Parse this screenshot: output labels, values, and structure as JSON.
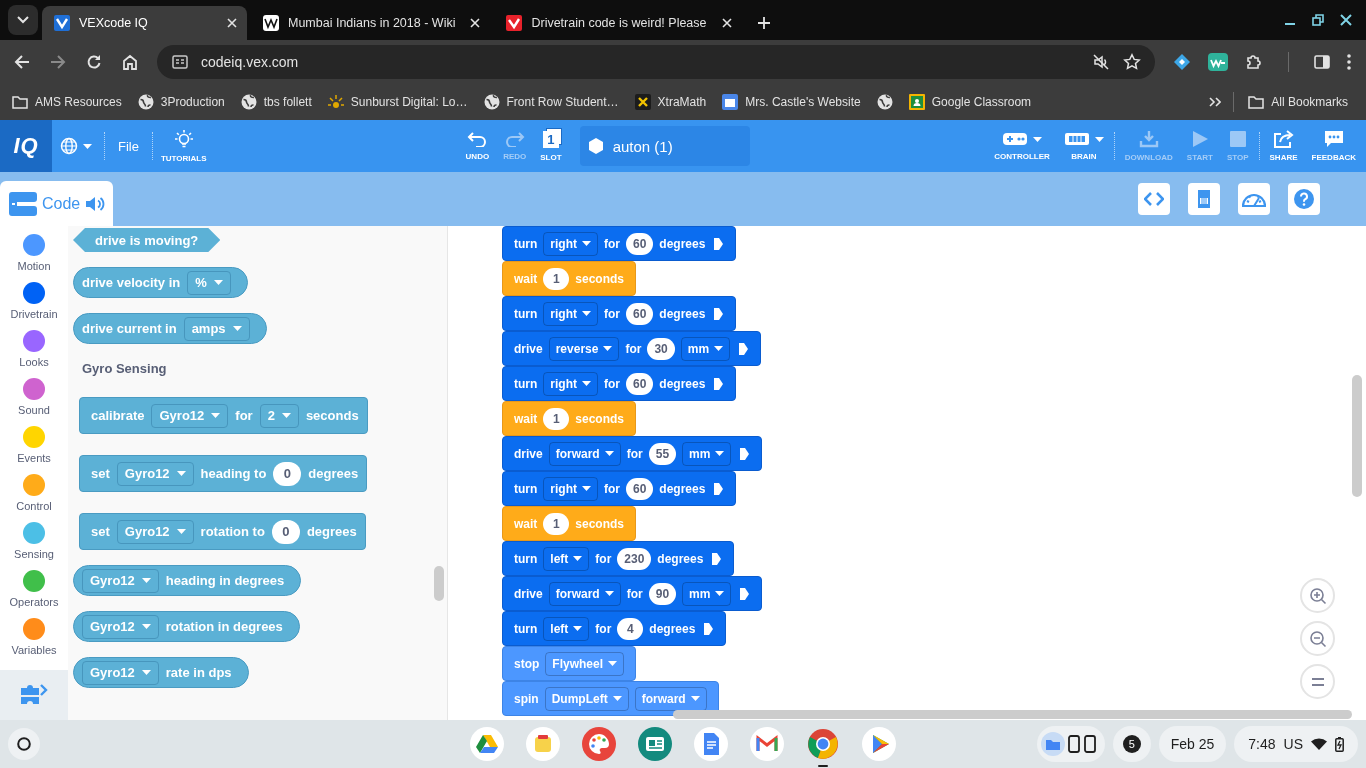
{
  "browser": {
    "tabs": [
      {
        "title": "VEXcode IQ",
        "selected": true
      },
      {
        "title": "Mumbai Indians in 2018 - Wiki",
        "selected": false
      },
      {
        "title": "Drivetrain code is weird! Please",
        "selected": false
      }
    ],
    "address": "codeiq.vex.com",
    "bookmarks": [
      {
        "kind": "folder",
        "title": "AMS Resources"
      },
      {
        "kind": "link",
        "title": "3Production"
      },
      {
        "kind": "link",
        "title": "tbs follett"
      },
      {
        "kind": "link",
        "title": "Sunburst Digital: Lo…"
      },
      {
        "kind": "link",
        "title": "Front Row Student…"
      },
      {
        "kind": "link",
        "title": "XtraMath"
      },
      {
        "kind": "link",
        "title": "Mrs. Castle's Website"
      },
      {
        "kind": "link"
      },
      {
        "kind": "link",
        "title": "Google Classroom"
      }
    ],
    "all_bookmarks": "All Bookmarks"
  },
  "app": {
    "logo": "IQ",
    "menu": "File",
    "tutorials": "TUTORIALS",
    "edit_buttons": [
      {
        "label": "UNDO",
        "disabled": false
      },
      {
        "label": "REDO",
        "disabled": true
      }
    ],
    "slot": {
      "label": "SLOT",
      "number": "1"
    },
    "project_name": "auton (1)",
    "device_buttons": [
      {
        "label": "CONTROLLER",
        "dropdown": true
      },
      {
        "label": "BRAIN",
        "dropdown": true
      }
    ],
    "run_buttons": [
      {
        "label": "DOWNLOAD",
        "disabled": true
      },
      {
        "label": "START",
        "disabled": true
      },
      {
        "label": "STOP",
        "disabled": true
      }
    ],
    "share_buttons": [
      {
        "label": "SHARE"
      },
      {
        "label": "FEEDBACK"
      }
    ],
    "code_tab": "Code"
  },
  "categories": [
    {
      "name": "Motion",
      "color": "#4c97ff"
    },
    {
      "name": "Drivetrain",
      "color": "#0062f5"
    },
    {
      "name": "Looks",
      "color": "#9966ff"
    },
    {
      "name": "Sound",
      "color": "#cf63cf"
    },
    {
      "name": "Events",
      "color": "#ffd500"
    },
    {
      "name": "Control",
      "color": "#ffab19"
    },
    {
      "name": "Sensing",
      "color": "#4cbfe6"
    },
    {
      "name": "Operators",
      "color": "#40bf4a"
    },
    {
      "name": "Variables",
      "color": "#ff8c1a"
    }
  ],
  "palette": [
    {
      "kind": "boolean",
      "parts": [
        {
          "kind": "label",
          "text": "drive is moving?"
        }
      ]
    },
    {
      "kind": "reporter",
      "parts": [
        {
          "kind": "label",
          "text": "drive velocity in"
        },
        {
          "kind": "dropdown",
          "text": "%"
        }
      ]
    },
    {
      "kind": "reporter",
      "parts": [
        {
          "kind": "label",
          "text": "drive current in"
        },
        {
          "kind": "dropdown",
          "text": "amps"
        }
      ]
    },
    {
      "kind": "heading",
      "text": "Gyro Sensing"
    },
    {
      "kind": "stack",
      "parts": [
        {
          "kind": "label",
          "text": "calibrate"
        },
        {
          "kind": "dropdown",
          "text": "Gyro12"
        },
        {
          "kind": "label",
          "text": "for"
        },
        {
          "kind": "dropdown",
          "text": "2"
        },
        {
          "kind": "label",
          "text": "seconds"
        }
      ]
    },
    {
      "kind": "stack",
      "parts": [
        {
          "kind": "label",
          "text": "set"
        },
        {
          "kind": "dropdown",
          "text": "Gyro12"
        },
        {
          "kind": "label",
          "text": "heading to"
        },
        {
          "kind": "number",
          "text": "0"
        },
        {
          "kind": "label",
          "text": "degrees"
        }
      ]
    },
    {
      "kind": "stack",
      "parts": [
        {
          "kind": "label",
          "text": "set"
        },
        {
          "kind": "dropdown",
          "text": "Gyro12"
        },
        {
          "kind": "label",
          "text": "rotation to"
        },
        {
          "kind": "number",
          "text": "0"
        },
        {
          "kind": "label",
          "text": "degrees"
        }
      ]
    },
    {
      "kind": "reporter",
      "parts": [
        {
          "kind": "dropdown",
          "text": "Gyro12"
        },
        {
          "kind": "label",
          "text": "heading in degrees"
        }
      ]
    },
    {
      "kind": "reporter",
      "parts": [
        {
          "kind": "dropdown",
          "text": "Gyro12"
        },
        {
          "kind": "label",
          "text": "rotation in degrees"
        }
      ]
    },
    {
      "kind": "reporter",
      "parts": [
        {
          "kind": "dropdown",
          "text": "Gyro12"
        },
        {
          "kind": "label",
          "text": "rate in dps"
        }
      ]
    }
  ],
  "workspace": [
    {
      "kind": "drivetrain",
      "parts": [
        {
          "kind": "label",
          "text": "turn"
        },
        {
          "kind": "dropdown",
          "text": "right"
        },
        {
          "kind": "label",
          "text": "for"
        },
        {
          "kind": "number",
          "text": "60"
        },
        {
          "kind": "label",
          "text": "degrees"
        },
        {
          "kind": "arrow"
        }
      ]
    },
    {
      "kind": "control",
      "parts": [
        {
          "kind": "label",
          "text": "wait"
        },
        {
          "kind": "number",
          "text": "1"
        },
        {
          "kind": "label",
          "text": "seconds"
        }
      ]
    },
    {
      "kind": "drivetrain",
      "parts": [
        {
          "kind": "label",
          "text": "turn"
        },
        {
          "kind": "dropdown",
          "text": "right"
        },
        {
          "kind": "label",
          "text": "for"
        },
        {
          "kind": "number",
          "text": "60"
        },
        {
          "kind": "label",
          "text": "degrees"
        },
        {
          "kind": "arrow"
        }
      ]
    },
    {
      "kind": "drivetrain",
      "parts": [
        {
          "kind": "label",
          "text": "drive"
        },
        {
          "kind": "dropdown",
          "text": "reverse"
        },
        {
          "kind": "label",
          "text": "for"
        },
        {
          "kind": "number",
          "text": "30"
        },
        {
          "kind": "dropdown",
          "text": "mm"
        },
        {
          "kind": "arrow"
        }
      ]
    },
    {
      "kind": "drivetrain",
      "parts": [
        {
          "kind": "label",
          "text": "turn"
        },
        {
          "kind": "dropdown",
          "text": "right"
        },
        {
          "kind": "label",
          "text": "for"
        },
        {
          "kind": "number",
          "text": "60"
        },
        {
          "kind": "label",
          "text": "degrees"
        },
        {
          "kind": "arrow"
        }
      ]
    },
    {
      "kind": "control",
      "parts": [
        {
          "kind": "label",
          "text": "wait"
        },
        {
          "kind": "number",
          "text": "1"
        },
        {
          "kind": "label",
          "text": "seconds"
        }
      ]
    },
    {
      "kind": "drivetrain",
      "parts": [
        {
          "kind": "label",
          "text": "drive"
        },
        {
          "kind": "dropdown",
          "text": "forward"
        },
        {
          "kind": "label",
          "text": "for"
        },
        {
          "kind": "number",
          "text": "55"
        },
        {
          "kind": "dropdown",
          "text": "mm"
        },
        {
          "kind": "arrow"
        }
      ]
    },
    {
      "kind": "drivetrain",
      "parts": [
        {
          "kind": "label",
          "text": "turn"
        },
        {
          "kind": "dropdown",
          "text": "right"
        },
        {
          "kind": "label",
          "text": "for"
        },
        {
          "kind": "number",
          "text": "60"
        },
        {
          "kind": "label",
          "text": "degrees"
        },
        {
          "kind": "arrow"
        }
      ]
    },
    {
      "kind": "control",
      "parts": [
        {
          "kind": "label",
          "text": "wait"
        },
        {
          "kind": "number",
          "text": "1"
        },
        {
          "kind": "label",
          "text": "seconds"
        }
      ]
    },
    {
      "kind": "drivetrain",
      "parts": [
        {
          "kind": "label",
          "text": "turn"
        },
        {
          "kind": "dropdown",
          "text": "left"
        },
        {
          "kind": "label",
          "text": "for"
        },
        {
          "kind": "number",
          "text": "230"
        },
        {
          "kind": "label",
          "text": "degrees"
        },
        {
          "kind": "arrow"
        }
      ]
    },
    {
      "kind": "drivetrain",
      "parts": [
        {
          "kind": "label",
          "text": "drive"
        },
        {
          "kind": "dropdown",
          "text": "forward"
        },
        {
          "kind": "label",
          "text": "for"
        },
        {
          "kind": "number",
          "text": "90"
        },
        {
          "kind": "dropdown",
          "text": "mm"
        },
        {
          "kind": "arrow"
        }
      ]
    },
    {
      "kind": "drivetrain",
      "parts": [
        {
          "kind": "label",
          "text": "turn"
        },
        {
          "kind": "dropdown",
          "text": "left"
        },
        {
          "kind": "label",
          "text": "for"
        },
        {
          "kind": "number",
          "text": "4"
        },
        {
          "kind": "label",
          "text": "degrees"
        },
        {
          "kind": "arrow"
        }
      ]
    },
    {
      "kind": "motion",
      "parts": [
        {
          "kind": "label",
          "text": "stop"
        },
        {
          "kind": "dropdown",
          "text": "Flywheel"
        }
      ]
    },
    {
      "kind": "motion",
      "parts": [
        {
          "kind": "label",
          "text": "spin"
        },
        {
          "kind": "dropdown",
          "text": "DumpLeft"
        },
        {
          "kind": "dropdown",
          "text": "forward"
        }
      ]
    }
  ],
  "taskbar": {
    "notifications": "5",
    "date": "Feb 25",
    "time": "7:48",
    "input_method": "US"
  }
}
